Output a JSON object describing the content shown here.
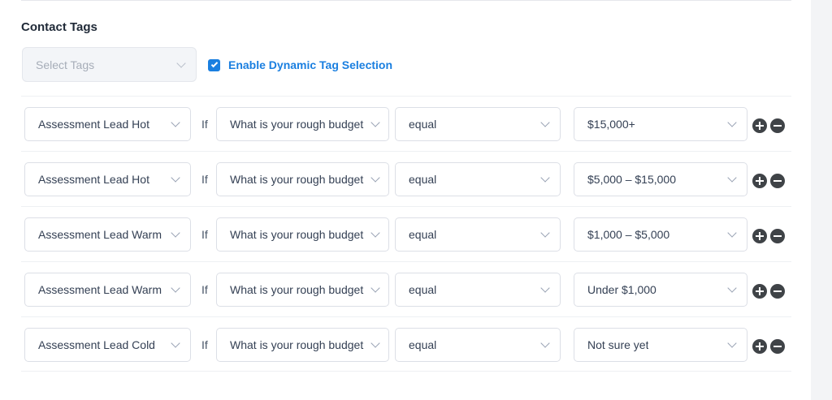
{
  "section": {
    "title": "Contact Tags"
  },
  "tag_select": {
    "placeholder": "Select Tags"
  },
  "dynamic": {
    "label": "Enable Dynamic Tag Selection",
    "checked": true
  },
  "rows": [
    {
      "tag": "Assessment Lead Hot",
      "if": "If",
      "question": "What is your rough budget?",
      "operator": "equal",
      "answer": "$15,000+"
    },
    {
      "tag": "Assessment Lead Hot",
      "if": "If",
      "question": "What is your rough budget?",
      "operator": "equal",
      "answer": "$5,000 – $15,000"
    },
    {
      "tag": "Assessment Lead Warm",
      "if": "If",
      "question": "What is your rough budget?",
      "operator": "equal",
      "answer": "$1,000 – $5,000"
    },
    {
      "tag": "Assessment Lead Warm",
      "if": "If",
      "question": "What is your rough budget?",
      "operator": "equal",
      "answer": "Under $1,000"
    },
    {
      "tag": "Assessment Lead Cold",
      "if": "If",
      "question": "What is your rough budget?",
      "operator": "equal",
      "answer": "Not sure yet"
    }
  ],
  "icons": {
    "chevron": "chevron-down-icon",
    "add": "plus-circle-icon",
    "remove": "minus-circle-icon",
    "check": "check-icon"
  },
  "colors": {
    "accent": "#1a7fe0",
    "circle_button": "#3f4347",
    "disabled_bg": "#f3f5f8"
  }
}
